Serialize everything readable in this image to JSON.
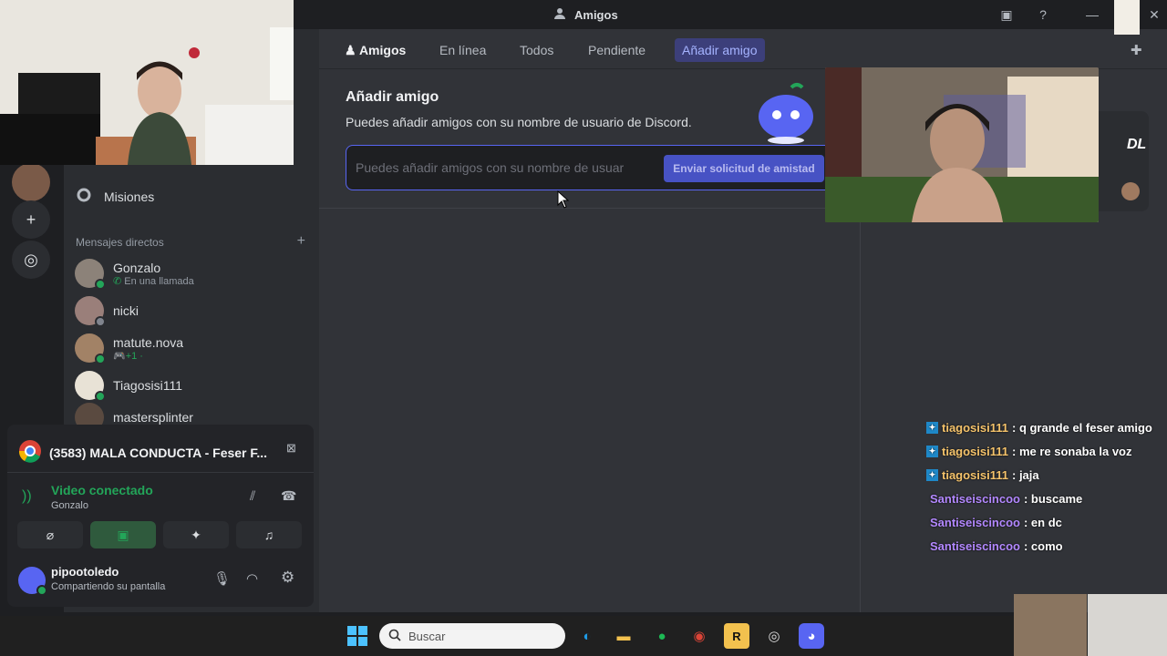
{
  "window": {
    "title": "Amigos"
  },
  "tabs": {
    "friends": "Amigos",
    "online": "En línea",
    "all": "Todos",
    "pending": "Pendiente",
    "add_friend": "Añadir amigo"
  },
  "add_friend": {
    "title": "Añadir amigo",
    "subtitle": "Puedes añadir amigos con su nombre de usuario de Discord.",
    "placeholder": "Puedes añadir amigos con su nombre de usuar",
    "send_label": "Enviar solicitud de amistad"
  },
  "sidebar": {
    "missions_label": "Misiones",
    "dm_header": "Mensajes directos",
    "dms": [
      {
        "name": "Gonzalo",
        "status": "En una llamada"
      },
      {
        "name": "nicki"
      },
      {
        "name": "matute.nova",
        "status": "+1 ·"
      },
      {
        "name": "Tiagosisi111"
      },
      {
        "name": "mastersplinter"
      }
    ]
  },
  "voice": {
    "now_playing": "(3583) MALA CONDUCTA - Feser F...",
    "status": "Video conectado",
    "channel": "Gonzalo"
  },
  "user": {
    "name": "pipootoledo",
    "status": "Compartiendo su pantalla"
  },
  "right_panel": {
    "badge": "DL"
  },
  "chat": [
    {
      "user": "tiagosisi111",
      "text": ": q grande el feser amigo",
      "color": "#f5c36b"
    },
    {
      "user": "tiagosisi111",
      "text": ": me re sonaba la voz",
      "color": "#f5c36b"
    },
    {
      "user": "tiagosisi111",
      "text": ": jaja",
      "color": "#f5c36b"
    },
    {
      "user": "Santiseiscincoo",
      "text": ": buscame",
      "color": "#b388ff"
    },
    {
      "user": "Santiseiscincoo",
      "text": ": en dc",
      "color": "#b388ff"
    },
    {
      "user": "Santiseiscincoo",
      "text": ": como",
      "color": "#b388ff"
    }
  ],
  "taskbar": {
    "search_placeholder": "Buscar"
  },
  "colors": {
    "accent": "#5865f2",
    "online": "#23a559"
  }
}
